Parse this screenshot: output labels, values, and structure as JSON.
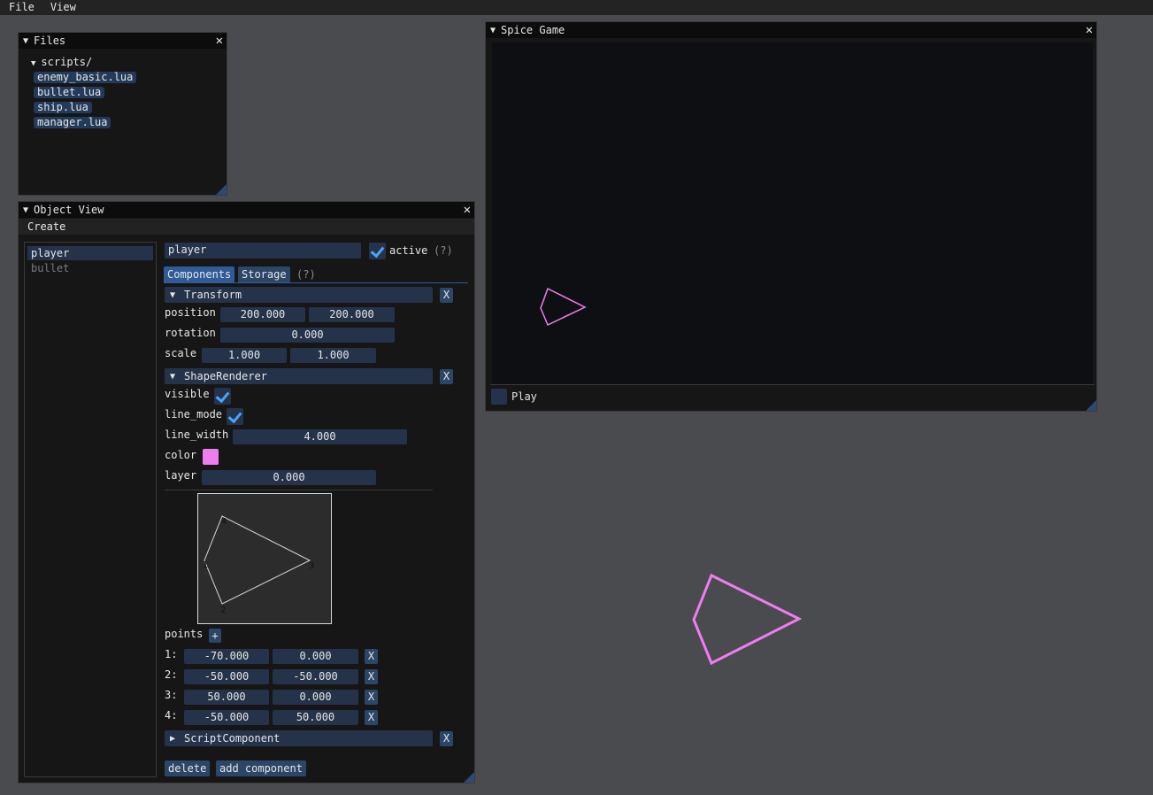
{
  "menubar": {
    "items": [
      "File",
      "View"
    ]
  },
  "files_window": {
    "title": "Files",
    "folder": "scripts/",
    "files": [
      "enemy_basic.lua",
      "bullet.lua",
      "ship.lua",
      "manager.lua"
    ]
  },
  "object_view": {
    "title": "Object View",
    "create_menu": "Create",
    "objects": [
      "player",
      "bullet"
    ],
    "selected_object": "player",
    "name_value": "player",
    "active_label": "active",
    "help": "(?)",
    "tabs": {
      "components": "Components",
      "storage": "Storage"
    },
    "transform": {
      "header": "Transform",
      "position_label": "position",
      "position_x": "200.000",
      "position_y": "200.000",
      "rotation_label": "rotation",
      "rotation": "0.000",
      "scale_label": "scale",
      "scale_x": "1.000",
      "scale_y": "1.000"
    },
    "shape_renderer": {
      "header": "ShapeRenderer",
      "visible_label": "visible",
      "line_mode_label": "line_mode",
      "line_width_label": "line_width",
      "line_width": "4.000",
      "color_label": "color",
      "color_hex": "#f07cf0",
      "layer_label": "layer",
      "layer": "0.000",
      "points_label": "points",
      "add_point": "+",
      "preview_labels": [
        "1",
        "2",
        "3",
        "4"
      ],
      "points": [
        {
          "idx": "1:",
          "x": "-70.000",
          "y": "0.000"
        },
        {
          "idx": "2:",
          "x": "-50.000",
          "y": "-50.000"
        },
        {
          "idx": "3:",
          "x": "50.000",
          "y": "0.000"
        },
        {
          "idx": "4:",
          "x": "-50.000",
          "y": "50.000"
        }
      ]
    },
    "script_component": {
      "header": "ScriptComponent"
    },
    "remove_glyph": "X",
    "delete_button": "delete",
    "add_component_button": "add component"
  },
  "game_window": {
    "title": "Spice Game",
    "play_label": "Play"
  },
  "close_glyph": "✕",
  "colors": {
    "shape": "#f07cf0",
    "accent": "#4aa3ff",
    "field_bg": "#25334a"
  }
}
